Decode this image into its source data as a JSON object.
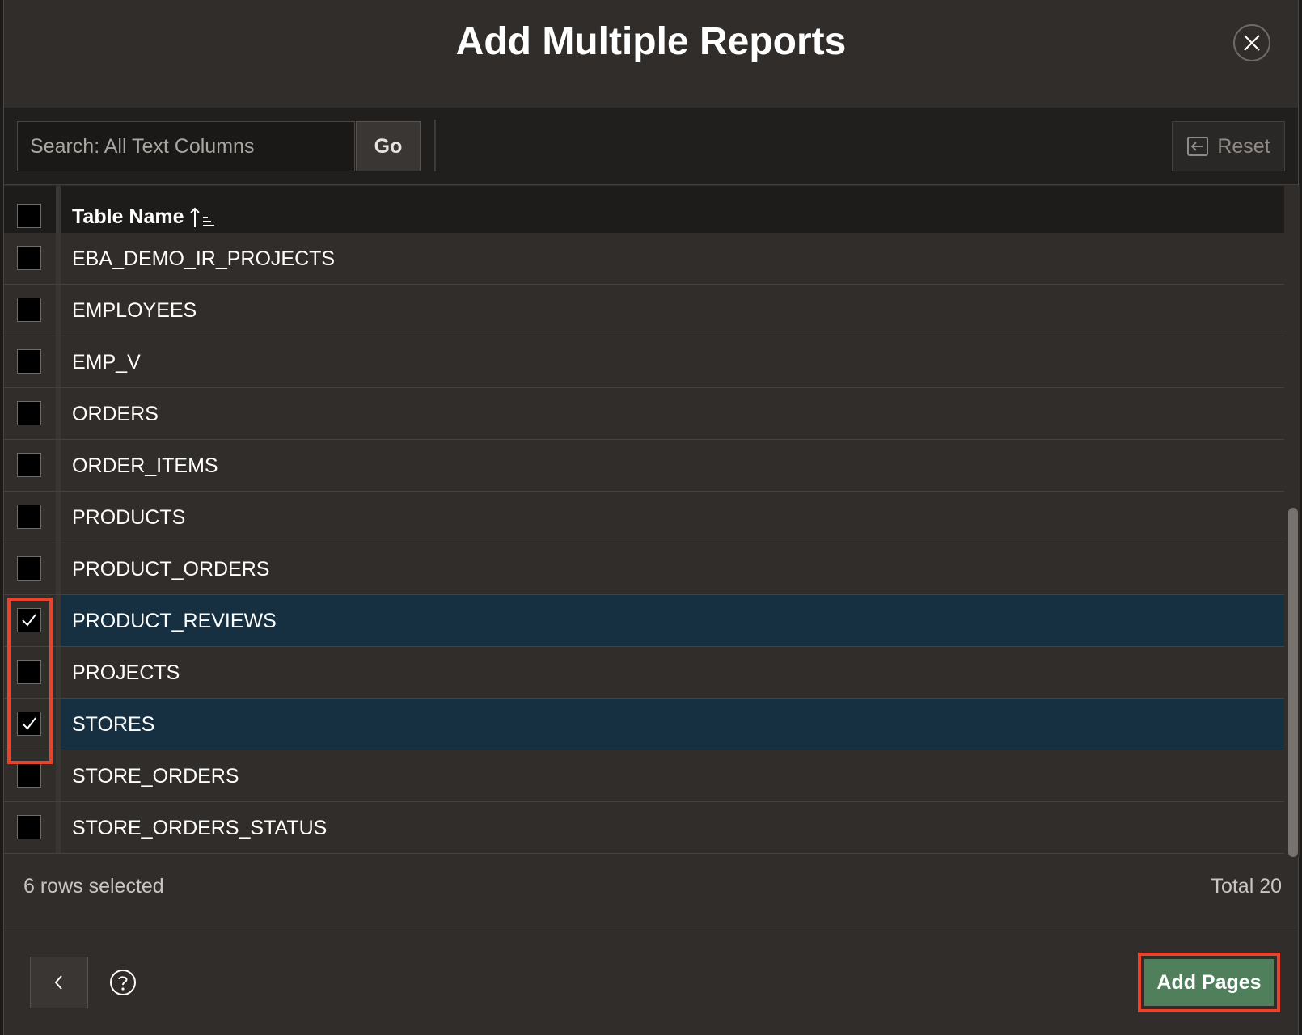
{
  "dialog": {
    "title": "Add Multiple Reports",
    "close_icon": "close-icon"
  },
  "toolbar": {
    "search_placeholder": "Search: All Text Columns",
    "go_label": "Go",
    "reset_label": "Reset",
    "reset_icon": "undo-arrow-icon"
  },
  "grid": {
    "header_label": "Table Name",
    "sort_icon": "sort-ascending-icon",
    "rows": [
      {
        "name": "EBA_DEMO_IR_PROJECTS",
        "checked": false
      },
      {
        "name": "EMPLOYEES",
        "checked": false
      },
      {
        "name": "EMP_V",
        "checked": false
      },
      {
        "name": "ORDERS",
        "checked": false
      },
      {
        "name": "ORDER_ITEMS",
        "checked": false
      },
      {
        "name": "PRODUCTS",
        "checked": false
      },
      {
        "name": "PRODUCT_ORDERS",
        "checked": false
      },
      {
        "name": "PRODUCT_REVIEWS",
        "checked": true
      },
      {
        "name": "PROJECTS",
        "checked": false
      },
      {
        "name": "STORES",
        "checked": true
      },
      {
        "name": "STORE_ORDERS",
        "checked": false
      },
      {
        "name": "STORE_ORDERS_STATUS",
        "checked": false
      }
    ]
  },
  "footer": {
    "rows_selected": "6 rows selected",
    "total": "Total 20"
  },
  "buttons": {
    "previous_icon": "chevron-left-icon",
    "help_icon": "help-icon",
    "add_pages_label": "Add Pages"
  },
  "colors": {
    "dialog_bg": "#312d2a",
    "selected_row": "#163042",
    "primary_button": "#4f7f5b",
    "highlight": "#e8432c"
  }
}
